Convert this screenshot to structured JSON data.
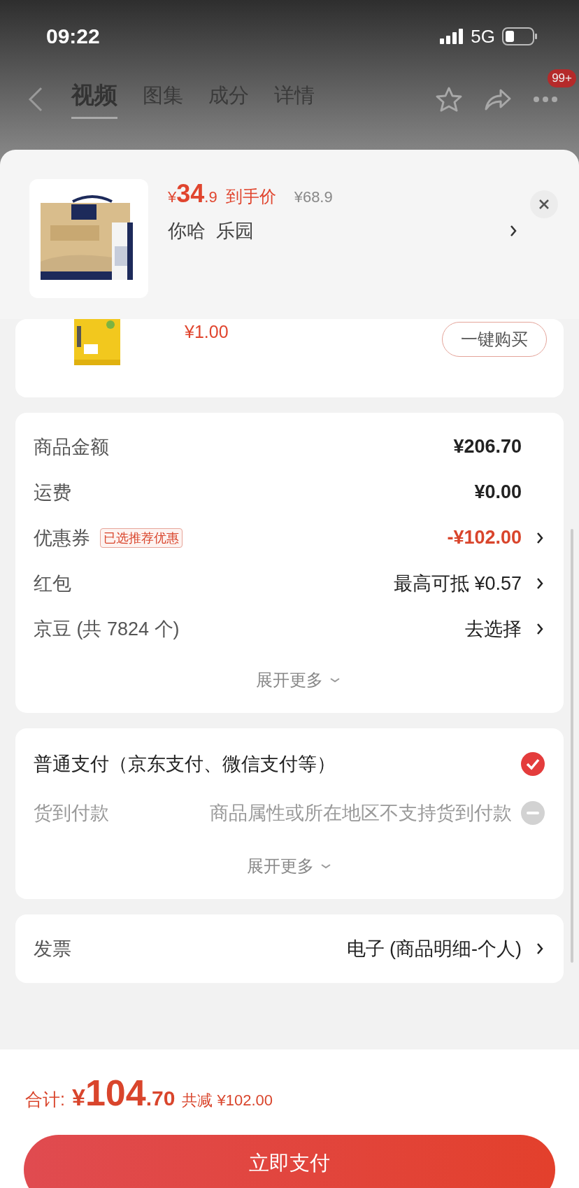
{
  "status_bar": {
    "time": "09:22",
    "network": "5G"
  },
  "nav": {
    "tabs": [
      {
        "label": "视频",
        "selected": true
      },
      {
        "label": "图集",
        "selected": false
      },
      {
        "label": "成分",
        "selected": false
      },
      {
        "label": "详情",
        "selected": false
      }
    ],
    "badge": "99+"
  },
  "product_sheet": {
    "currency": "¥",
    "price_int": "34",
    "price_dec": ".9",
    "price_label": "到手价",
    "original_price": "¥68.9",
    "name": "你哈  乐园"
  },
  "addon_item": {
    "price": "¥1.00",
    "button": "一键购买"
  },
  "fees": {
    "rows": [
      {
        "label": "商品金额",
        "value": "¥206.70",
        "highlight": false
      },
      {
        "label": "运费",
        "value": "¥0.00",
        "highlight": false
      },
      {
        "label": "优惠券",
        "tag": "已选推荐优惠",
        "value": "-¥102.00",
        "highlight": true,
        "arrow": true
      },
      {
        "label": "红包",
        "value": "最高可抵 ¥0.57",
        "highlight": false,
        "arrow": true
      },
      {
        "label": "京豆 (共 7824 个)",
        "value": "去选择",
        "highlight": false,
        "arrow": true
      }
    ],
    "more": "展开更多"
  },
  "payment": {
    "options": [
      {
        "label": "普通支付（京东支付、微信支付等）",
        "selected": true,
        "disabled": false
      },
      {
        "label": "货到付款",
        "note": "商品属性或所在地区不支持货到付款",
        "selected": false,
        "disabled": true
      }
    ],
    "more": "展开更多"
  },
  "invoice": {
    "label": "发票",
    "value": "电子 (商品明细-个人)"
  },
  "footer": {
    "total_label": "合计:",
    "currency": "¥",
    "total_int": "104",
    "total_dec": ".70",
    "saving": "共减 ¥102.00",
    "pay_button": "立即支付"
  }
}
